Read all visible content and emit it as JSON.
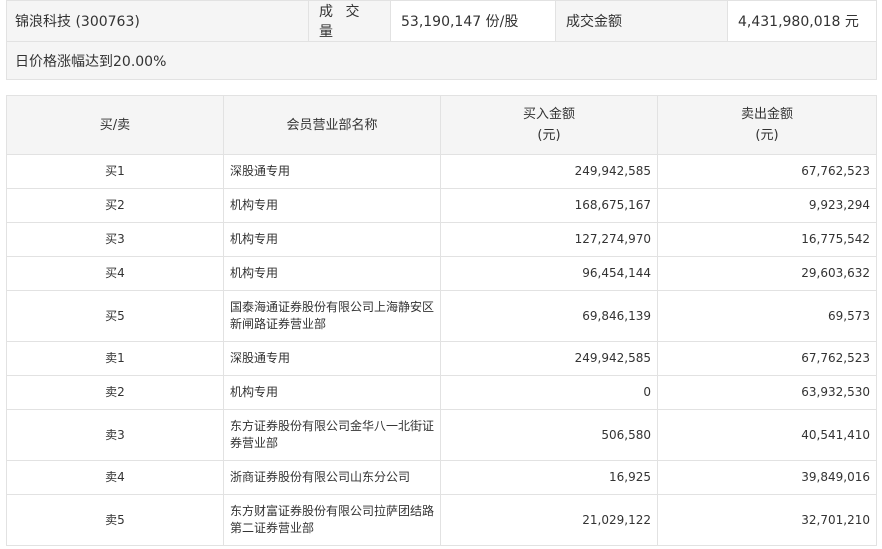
{
  "stock": {
    "name_code": "锦浪科技 (300763)",
    "volume_label": "成 交 量",
    "volume_value": "53,190,147 份/股",
    "amount_label": "成交金额",
    "amount_value": "4,431,980,018 元",
    "reason": "日价格涨幅达到20.00%"
  },
  "table": {
    "headers": {
      "side": "买/卖",
      "branch": "会员营业部名称",
      "buy_line1": "买入金额",
      "buy_line2": "(元)",
      "sell_line1": "卖出金额",
      "sell_line2": "(元)"
    },
    "rows": [
      {
        "side": "买1",
        "branch_line1": "深股通专用",
        "branch_line2": "",
        "buy": "249,942,585",
        "sell": "67,762,523"
      },
      {
        "side": "买2",
        "branch_line1": "机构专用",
        "branch_line2": "",
        "buy": "168,675,167",
        "sell": "9,923,294"
      },
      {
        "side": "买3",
        "branch_line1": "机构专用",
        "branch_line2": "",
        "buy": "127,274,970",
        "sell": "16,775,542"
      },
      {
        "side": "买4",
        "branch_line1": "机构专用",
        "branch_line2": "",
        "buy": "96,454,144",
        "sell": "29,603,632"
      },
      {
        "side": "买5",
        "branch_line1": "国泰海通证券股份有限公司上海静安区",
        "branch_line2": "新闸路证券营业部",
        "buy": "69,846,139",
        "sell": "69,573"
      },
      {
        "side": "卖1",
        "branch_line1": "深股通专用",
        "branch_line2": "",
        "buy": "249,942,585",
        "sell": "67,762,523"
      },
      {
        "side": "卖2",
        "branch_line1": "机构专用",
        "branch_line2": "",
        "buy": "0",
        "sell": "63,932,530"
      },
      {
        "side": "卖3",
        "branch_line1": "东方证券股份有限公司金华八一北街证",
        "branch_line2": "券营业部",
        "buy": "506,580",
        "sell": "40,541,410"
      },
      {
        "side": "卖4",
        "branch_line1": "浙商证券股份有限公司山东分公司",
        "branch_line2": "",
        "buy": "16,925",
        "sell": "39,849,016"
      },
      {
        "side": "卖5",
        "branch_line1": "东方财富证券股份有限公司拉萨团结路",
        "branch_line2": "第二证券营业部",
        "buy": "21,029,122",
        "sell": "32,701,210"
      }
    ]
  }
}
